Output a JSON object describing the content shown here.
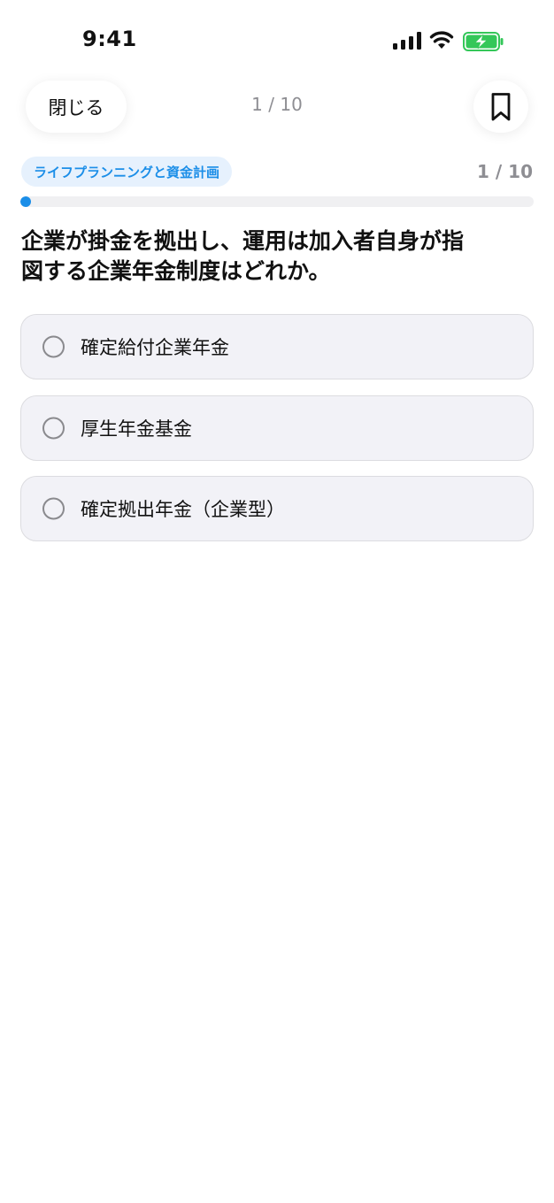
{
  "status_bar": {
    "time": "9:41",
    "icons": [
      "cellular-signal-icon",
      "wifi-icon",
      "battery-charging-icon"
    ],
    "battery_color": "#34c759"
  },
  "nav": {
    "close_label": "閉じる",
    "counter": "1 / 10",
    "bookmark_icon": "bookmark-icon"
  },
  "quiz": {
    "category": "ライフプランニングと資金計画",
    "counter": "1 / 10",
    "progress": 0.1,
    "question": "企業が掛金を拠出し、運用は加入者自身が指図する企業年金制度はどれか。",
    "options": [
      {
        "label": "確定給付企業年金"
      },
      {
        "label": "厚生年金基金"
      },
      {
        "label": "確定拠出年金（企業型）"
      }
    ]
  },
  "colors": {
    "accent": "#1b8ee8",
    "badge_bg": "#e6f1fd",
    "option_bg": "#f2f2f7",
    "muted_text": "#8e8e93"
  }
}
